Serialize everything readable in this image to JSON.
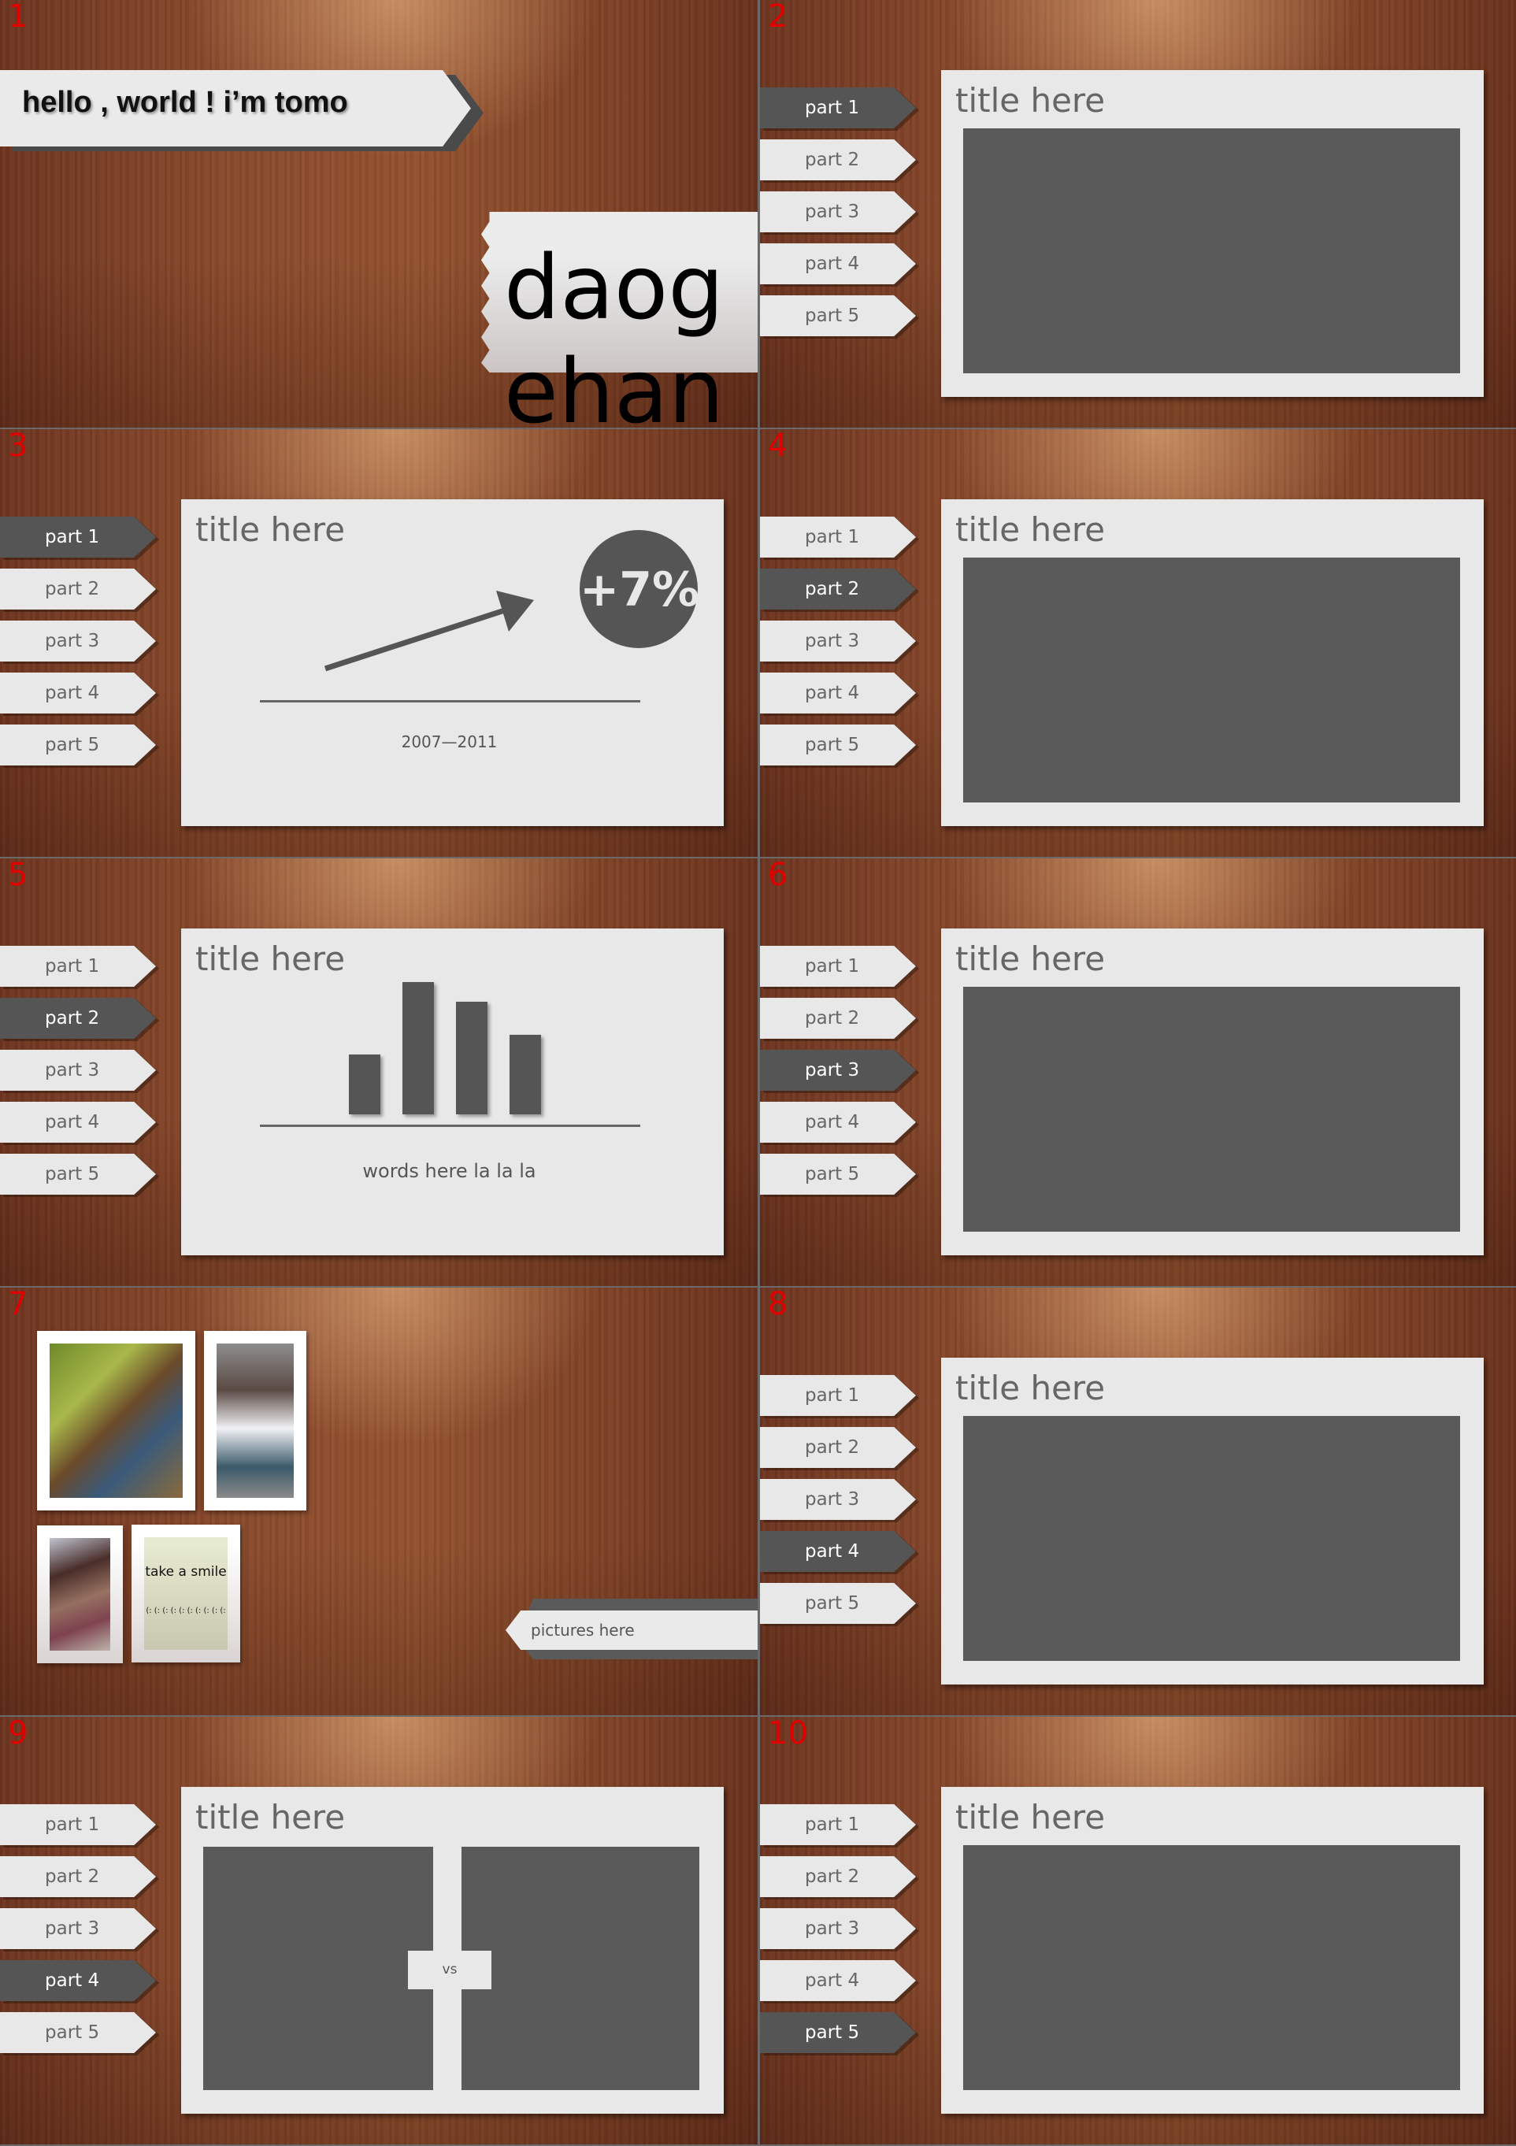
{
  "colors": {
    "tab_active": "#555555",
    "tab_inactive": "#e8e8e8",
    "slide_number": "#e00000",
    "panel": "#e8e8e8",
    "placeholder": "#5a5a5a"
  },
  "parts": [
    "part 1",
    "part 2",
    "part 3",
    "part 4",
    "part 5"
  ],
  "slides": [
    {
      "number": "1",
      "banner": "hello , world !  i’m  tomo",
      "big_text": "daog ehan"
    },
    {
      "number": "2",
      "active_part": 0,
      "title": "title here"
    },
    {
      "number": "3",
      "active_part": 0,
      "title": "title here",
      "badge": "+7%",
      "caption": "2007—2011",
      "trend-icon": "arrow-up-right"
    },
    {
      "number": "4",
      "active_part": 1,
      "title": "title here"
    },
    {
      "number": "5",
      "active_part": 1,
      "title": "title here",
      "caption": "words here la la la",
      "bar_levels_percent": [
        45,
        100,
        85,
        60
      ]
    },
    {
      "number": "6",
      "active_part": 2,
      "title": "title here"
    },
    {
      "number": "7",
      "label": "pictures here",
      "note_text": "take a smile",
      "note_tabs": "(: (: (: (: (: (: (: (: (: (:"
    },
    {
      "number": "8",
      "active_part": 3,
      "title": "title here"
    },
    {
      "number": "9",
      "active_part": 3,
      "title": "title here",
      "vs": "vs"
    },
    {
      "number": "10",
      "active_part": 4,
      "title": "title here"
    }
  ]
}
